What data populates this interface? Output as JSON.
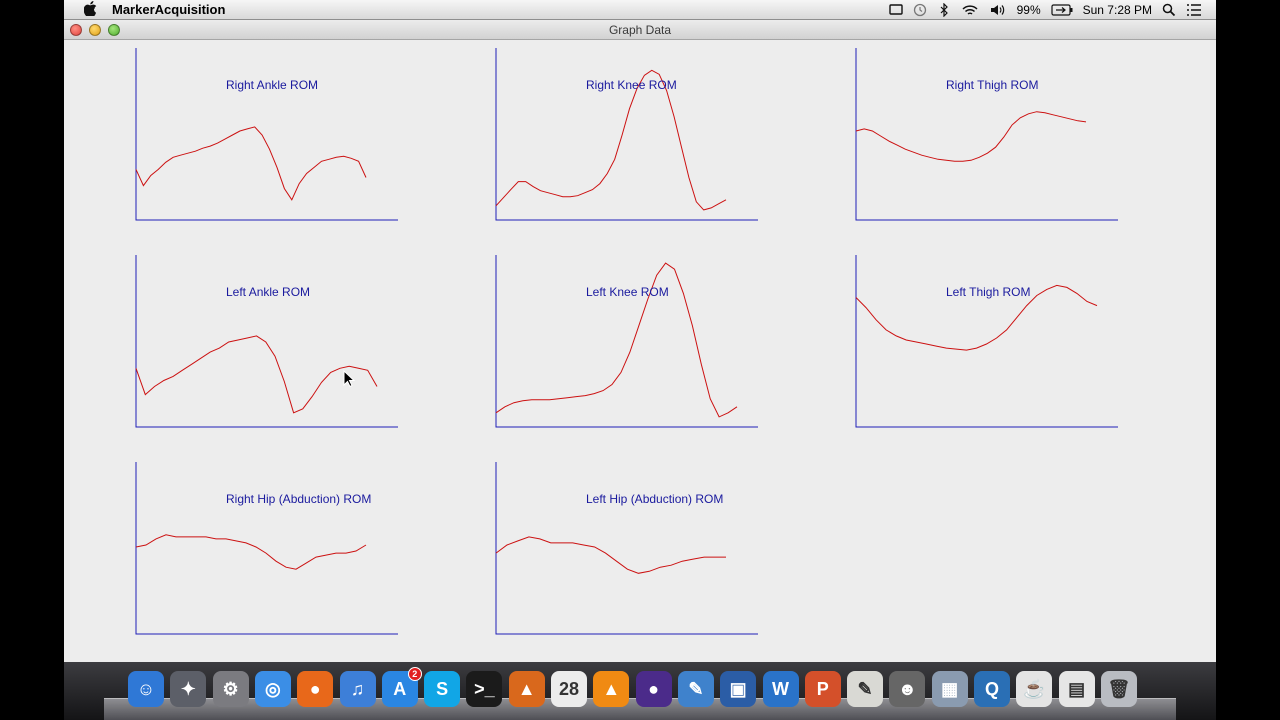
{
  "menubar": {
    "app_name": "MarkerAcquisition",
    "battery": "99%",
    "clock": "Sun 7:28 PM",
    "icons": [
      "apple-icon",
      "screen-mirroring-icon",
      "time-machine-icon",
      "bluetooth-icon",
      "wifi-icon",
      "volume-icon",
      "battery-icon",
      "spotlight-icon",
      "notification-center-icon"
    ]
  },
  "window": {
    "title": "Graph Data"
  },
  "graphs": [
    {
      "title": "Right Ankle ROM",
      "type": "line",
      "y": [
        50,
        34,
        44,
        50,
        57,
        62,
        64,
        66,
        68,
        71,
        73,
        76,
        80,
        84,
        88,
        90,
        92,
        84,
        70,
        52,
        31,
        20,
        36,
        46,
        52,
        58,
        60,
        62,
        63,
        61,
        58,
        42
      ]
    },
    {
      "title": "Right Knee ROM",
      "type": "line",
      "y": [
        14,
        22,
        30,
        38,
        38,
        33,
        29,
        27,
        25,
        23,
        23,
        24,
        27,
        30,
        36,
        46,
        60,
        84,
        110,
        130,
        143,
        148,
        144,
        128,
        102,
        72,
        42,
        18,
        10,
        12,
        16,
        20
      ]
    },
    {
      "title": "Right Thigh ROM",
      "type": "line",
      "y": [
        88,
        90,
        88,
        83,
        78,
        74,
        70,
        67,
        64,
        62,
        60,
        59,
        58,
        58,
        59,
        62,
        66,
        72,
        82,
        94,
        101,
        105,
        107,
        106,
        104,
        102,
        100,
        98,
        97
      ]
    },
    {
      "title": "Left Ankle ROM",
      "type": "line",
      "y": [
        58,
        32,
        40,
        46,
        50,
        56,
        62,
        68,
        74,
        78,
        84,
        86,
        88,
        90,
        84,
        70,
        45,
        14,
        18,
        30,
        44,
        54,
        58,
        60,
        58,
        56,
        40
      ]
    },
    {
      "title": "Left Knee ROM",
      "type": "line",
      "y": [
        14,
        20,
        24,
        26,
        27,
        27,
        27,
        28,
        29,
        30,
        31,
        33,
        36,
        42,
        54,
        74,
        100,
        126,
        150,
        162,
        156,
        132,
        100,
        62,
        28,
        10,
        14,
        20
      ]
    },
    {
      "title": "Left Thigh ROM",
      "type": "line",
      "y": [
        128,
        118,
        106,
        96,
        90,
        86,
        84,
        82,
        80,
        78,
        77,
        76,
        78,
        82,
        88,
        96,
        108,
        120,
        130,
        136,
        140,
        138,
        132,
        124,
        120
      ]
    },
    {
      "title": "Right Hip (Abduction) ROM",
      "type": "line",
      "y": [
        86,
        88,
        94,
        98,
        96,
        96,
        96,
        96,
        94,
        94,
        92,
        90,
        86,
        80,
        72,
        66,
        64,
        70,
        76,
        78,
        80,
        80,
        82,
        88
      ]
    },
    {
      "title": "Left Hip (Abduction) ROM",
      "type": "line",
      "y": [
        80,
        88,
        92,
        96,
        94,
        90,
        90,
        90,
        88,
        86,
        80,
        72,
        64,
        60,
        62,
        66,
        68,
        72,
        74,
        76,
        76,
        76
      ]
    }
  ],
  "dock": {
    "items": [
      {
        "name": "finder-icon",
        "color": "#2f78d6",
        "glyph": "☺"
      },
      {
        "name": "launchpad-icon",
        "color": "#5c5f68",
        "glyph": "✦"
      },
      {
        "name": "system-preferences-icon",
        "color": "#7b7b80",
        "glyph": "⚙"
      },
      {
        "name": "safari-icon",
        "color": "#3b8ee6",
        "glyph": "◎"
      },
      {
        "name": "firefox-icon",
        "color": "#e8681a",
        "glyph": "●"
      },
      {
        "name": "itunes-icon",
        "color": "#3d7fd8",
        "glyph": "♫"
      },
      {
        "name": "app-store-icon",
        "color": "#2a86e2",
        "glyph": "A",
        "badge": "2"
      },
      {
        "name": "skype-icon",
        "color": "#11a6e6",
        "glyph": "S"
      },
      {
        "name": "terminal-icon",
        "color": "#1b1b1b",
        "glyph": ">_"
      },
      {
        "name": "matlab-icon",
        "color": "#d9681c",
        "glyph": "▲"
      },
      {
        "name": "calendar-icon",
        "color": "#ececec",
        "glyph": "28"
      },
      {
        "name": "vlc-icon",
        "color": "#f08a13",
        "glyph": "▲"
      },
      {
        "name": "eclipse-icon",
        "color": "#4b2b8a",
        "glyph": "●"
      },
      {
        "name": "xcode-icon",
        "color": "#3f82cc",
        "glyph": "✎"
      },
      {
        "name": "virtualbox-icon",
        "color": "#2b5da6",
        "glyph": "▣"
      },
      {
        "name": "word-icon",
        "color": "#2a73c9",
        "glyph": "W"
      },
      {
        "name": "powerpoint-icon",
        "color": "#d4502a",
        "glyph": "P"
      },
      {
        "name": "textedit-icon",
        "color": "#d9d9d4",
        "glyph": "✎"
      },
      {
        "name": "automator-icon",
        "color": "#666",
        "glyph": "☻"
      },
      {
        "name": "preview-icon",
        "color": "#8a9bb0",
        "glyph": "▦"
      },
      {
        "name": "quicktime-icon",
        "color": "#2a6fb5",
        "glyph": "Q"
      },
      {
        "name": "coffee-cup-icon",
        "color": "#e4e4e4",
        "glyph": "☕"
      },
      {
        "name": "documents-stack-icon",
        "color": "#e6e6e6",
        "glyph": "▤"
      },
      {
        "name": "trash-icon",
        "color": "#b9bcc2",
        "glyph": "🗑"
      }
    ]
  }
}
